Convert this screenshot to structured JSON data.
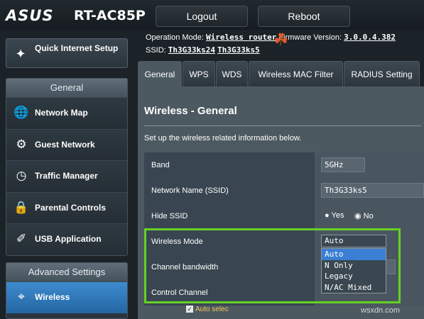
{
  "header": {
    "logo": "ASUS",
    "model": "RT-AC85P",
    "logout_label": "Logout",
    "reboot_label": "Reboot",
    "operation_mode_label": "Operation Mode:",
    "operation_mode_value": "Wireless router",
    "firmware_label": "Firmware Version:",
    "firmware_value": "3.0.0.4.382",
    "ssid_label": "SSID:",
    "ssid_1": "Th3G33ks24",
    "ssid_2": "Th3G33ks5"
  },
  "sidebar": {
    "quick_setup": "Quick Internet Setup",
    "general_head": "General",
    "general_items": [
      {
        "label": "Network Map",
        "icon": "network-map-icon"
      },
      {
        "label": "Guest Network",
        "icon": "guest-network-icon"
      },
      {
        "label": "Traffic Manager",
        "icon": "traffic-manager-icon"
      },
      {
        "label": "Parental Controls",
        "icon": "parental-controls-icon"
      },
      {
        "label": "USB Application",
        "icon": "usb-icon"
      }
    ],
    "advanced_head": "Advanced Settings",
    "advanced_items": [
      {
        "label": "Wireless",
        "icon": "wireless-icon",
        "active": true
      }
    ]
  },
  "tabs": [
    "General",
    "WPS",
    "WDS",
    "Wireless MAC Filter",
    "RADIUS Setting"
  ],
  "main": {
    "title": "Wireless - General",
    "description": "Set up the wireless related information below.",
    "rows": [
      {
        "label": "Band",
        "value": "5GHz"
      },
      {
        "label": "Network Name (SSID)",
        "value": "Th3G33ks5"
      },
      {
        "label": "Hide SSID",
        "yes": "Yes",
        "no": "No",
        "selected": "No"
      },
      {
        "label": "Wireless Mode",
        "value": "Auto"
      },
      {
        "label": "Channel bandwidth"
      },
      {
        "label": "Control Channel"
      }
    ],
    "wireless_mode_options": [
      "Auto",
      "N Only",
      "Legacy",
      "N/AC Mixed"
    ],
    "auto_select_label": "Auto selec"
  },
  "watermark": "wsxdn.com",
  "colors": {
    "highlight_border": "#66d025",
    "active_menu": "#2f78bf",
    "dropdown_highlight": "#3b7fd4"
  }
}
